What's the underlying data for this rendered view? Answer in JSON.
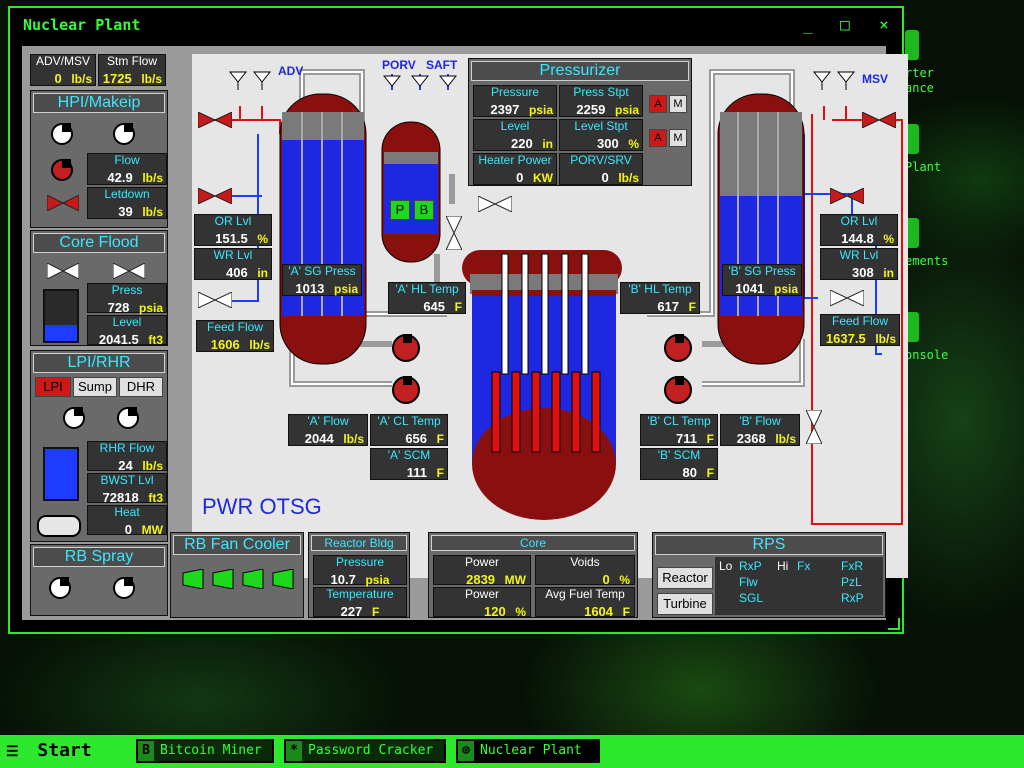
{
  "window": {
    "title": "Nuclear Plant",
    "min": "_",
    "max": "□",
    "close": "×"
  },
  "desktop": {
    "labels": [
      "rter",
      "ance",
      "Plant",
      "ements",
      "onsole"
    ]
  },
  "taskbar": {
    "start": "Start",
    "tasks": [
      {
        "icon": "B",
        "label": "Bitcoin Miner"
      },
      {
        "icon": "*",
        "label": "Password Cracker"
      },
      {
        "icon": "⊗",
        "label": "Nuclear Plant"
      }
    ]
  },
  "left": {
    "adv_msv": {
      "label": "ADV/MSV",
      "value": "0",
      "unit": "lb/s"
    },
    "stm_flow": {
      "label": "Stm Flow",
      "value": "1725",
      "unit": "lb/s"
    },
    "hpi": {
      "title": "HPI/Makeip",
      "flow_label": "Flow",
      "flow": "42.9",
      "flow_unit": "lb/s",
      "letdown_label": "Letdown",
      "letdown": "39",
      "letdown_unit": "lb/s"
    },
    "core_flood": {
      "title": "Core Flood",
      "press_label": "Press",
      "press": "728",
      "press_unit": "psia",
      "level_label": "Level",
      "level": "2041.5",
      "level_unit": "ft3"
    },
    "lpi": {
      "title": "LPI/RHR",
      "tabs": [
        "LPI",
        "Sump",
        "DHR"
      ],
      "rhr_label": "RHR Flow",
      "rhr": "24",
      "rhr_unit": "lb/s",
      "bwst_label": "BWST Lvl",
      "bwst": "72818",
      "bwst_unit": "ft3",
      "heat_label": "Heat",
      "heat": "0",
      "heat_unit": "MW"
    },
    "rb_spray": {
      "title": "RB Spray"
    }
  },
  "diagram": {
    "title": "PWR OTSG",
    "adv": "ADV",
    "msv": "MSV",
    "porv": "PORV",
    "saft": "SAFT",
    "pressurizer": {
      "title": "Pressurizer",
      "pressure_label": "Pressure",
      "pressure": "2397",
      "pressure_unit": "psia",
      "press_stpt_label": "Press Stpt",
      "press_stpt": "2259",
      "press_stpt_unit": "psia",
      "level_label": "Level",
      "level": "220",
      "level_unit": "in",
      "level_stpt_label": "Level Stpt",
      "level_stpt": "300",
      "level_stpt_unit": "%",
      "heater_label": "Heater Power",
      "heater": "0",
      "heater_unit": "KW",
      "porv_label": "PORV/SRV",
      "porv": "0",
      "porv_unit": "lb/s",
      "mode_a": "A",
      "mode_m": "M",
      "heater_p": "P",
      "heater_b": "B"
    },
    "sg_a": {
      "or_label": "OR Lvl",
      "or": "151.5",
      "or_unit": "%",
      "wr_label": "WR Lvl",
      "wr": "406",
      "wr_unit": "in",
      "press_label": "'A' SG Press",
      "press": "1013",
      "press_unit": "psia",
      "feed_label": "Feed Flow",
      "feed": "1606",
      "feed_unit": "lb/s",
      "hl_label": "'A' HL Temp",
      "hl": "645",
      "hl_unit": "F",
      "flow_label": "'A' Flow",
      "flow": "2044",
      "flow_unit": "lb/s",
      "cl_label": "'A' CL Temp",
      "cl": "656",
      "cl_unit": "F",
      "scm_label": "'A' SCM",
      "scm": "111",
      "scm_unit": "F"
    },
    "sg_b": {
      "or_label": "OR Lvl",
      "or": "144.8",
      "or_unit": "%",
      "wr_label": "WR Lvl",
      "wr": "308",
      "wr_unit": "in",
      "press_label": "'B' SG Press",
      "press": "1041",
      "press_unit": "psia",
      "feed_label": "Feed Flow",
      "feed": "1637.5",
      "feed_unit": "lb/s",
      "hl_label": "'B' HL Temp",
      "hl": "617",
      "hl_unit": "F",
      "flow_label": "'B' Flow",
      "flow": "2368",
      "flow_unit": "lb/s",
      "cl_label": "'B' CL Temp",
      "cl": "711",
      "cl_unit": "F",
      "scm_label": "'B' SCM",
      "scm": "80",
      "scm_unit": "F"
    }
  },
  "bottom": {
    "rb_fan": {
      "title": "RB Fan Cooler"
    },
    "reactor_bldg": {
      "title": "Reactor Bldg",
      "pressure_label": "Pressure",
      "pressure": "10.7",
      "pressure_unit": "psia",
      "temp_label": "Temperature",
      "temp": "227",
      "temp_unit": "F"
    },
    "core": {
      "title": "Core",
      "power_label": "Power",
      "power_mw": "2839",
      "power_mw_unit": "MW",
      "voids_label": "Voids",
      "voids": "0",
      "voids_unit": "%",
      "power_pct": "120",
      "power_pct_unit": "%",
      "fuel_label": "Avg Fuel Temp",
      "fuel": "1604",
      "fuel_unit": "F"
    },
    "rps": {
      "title": "RPS",
      "reactor_btn": "Reactor",
      "turbine_btn": "Turbine",
      "trips": {
        "lo": "Lo",
        "rxp": "RxP",
        "hi": "Hi",
        "fx": "Fx",
        "fxr": "FxR",
        "flw": "Flw",
        "pzl": "PzL",
        "sgl": "SGL",
        "rxp2": "RxP"
      }
    }
  }
}
